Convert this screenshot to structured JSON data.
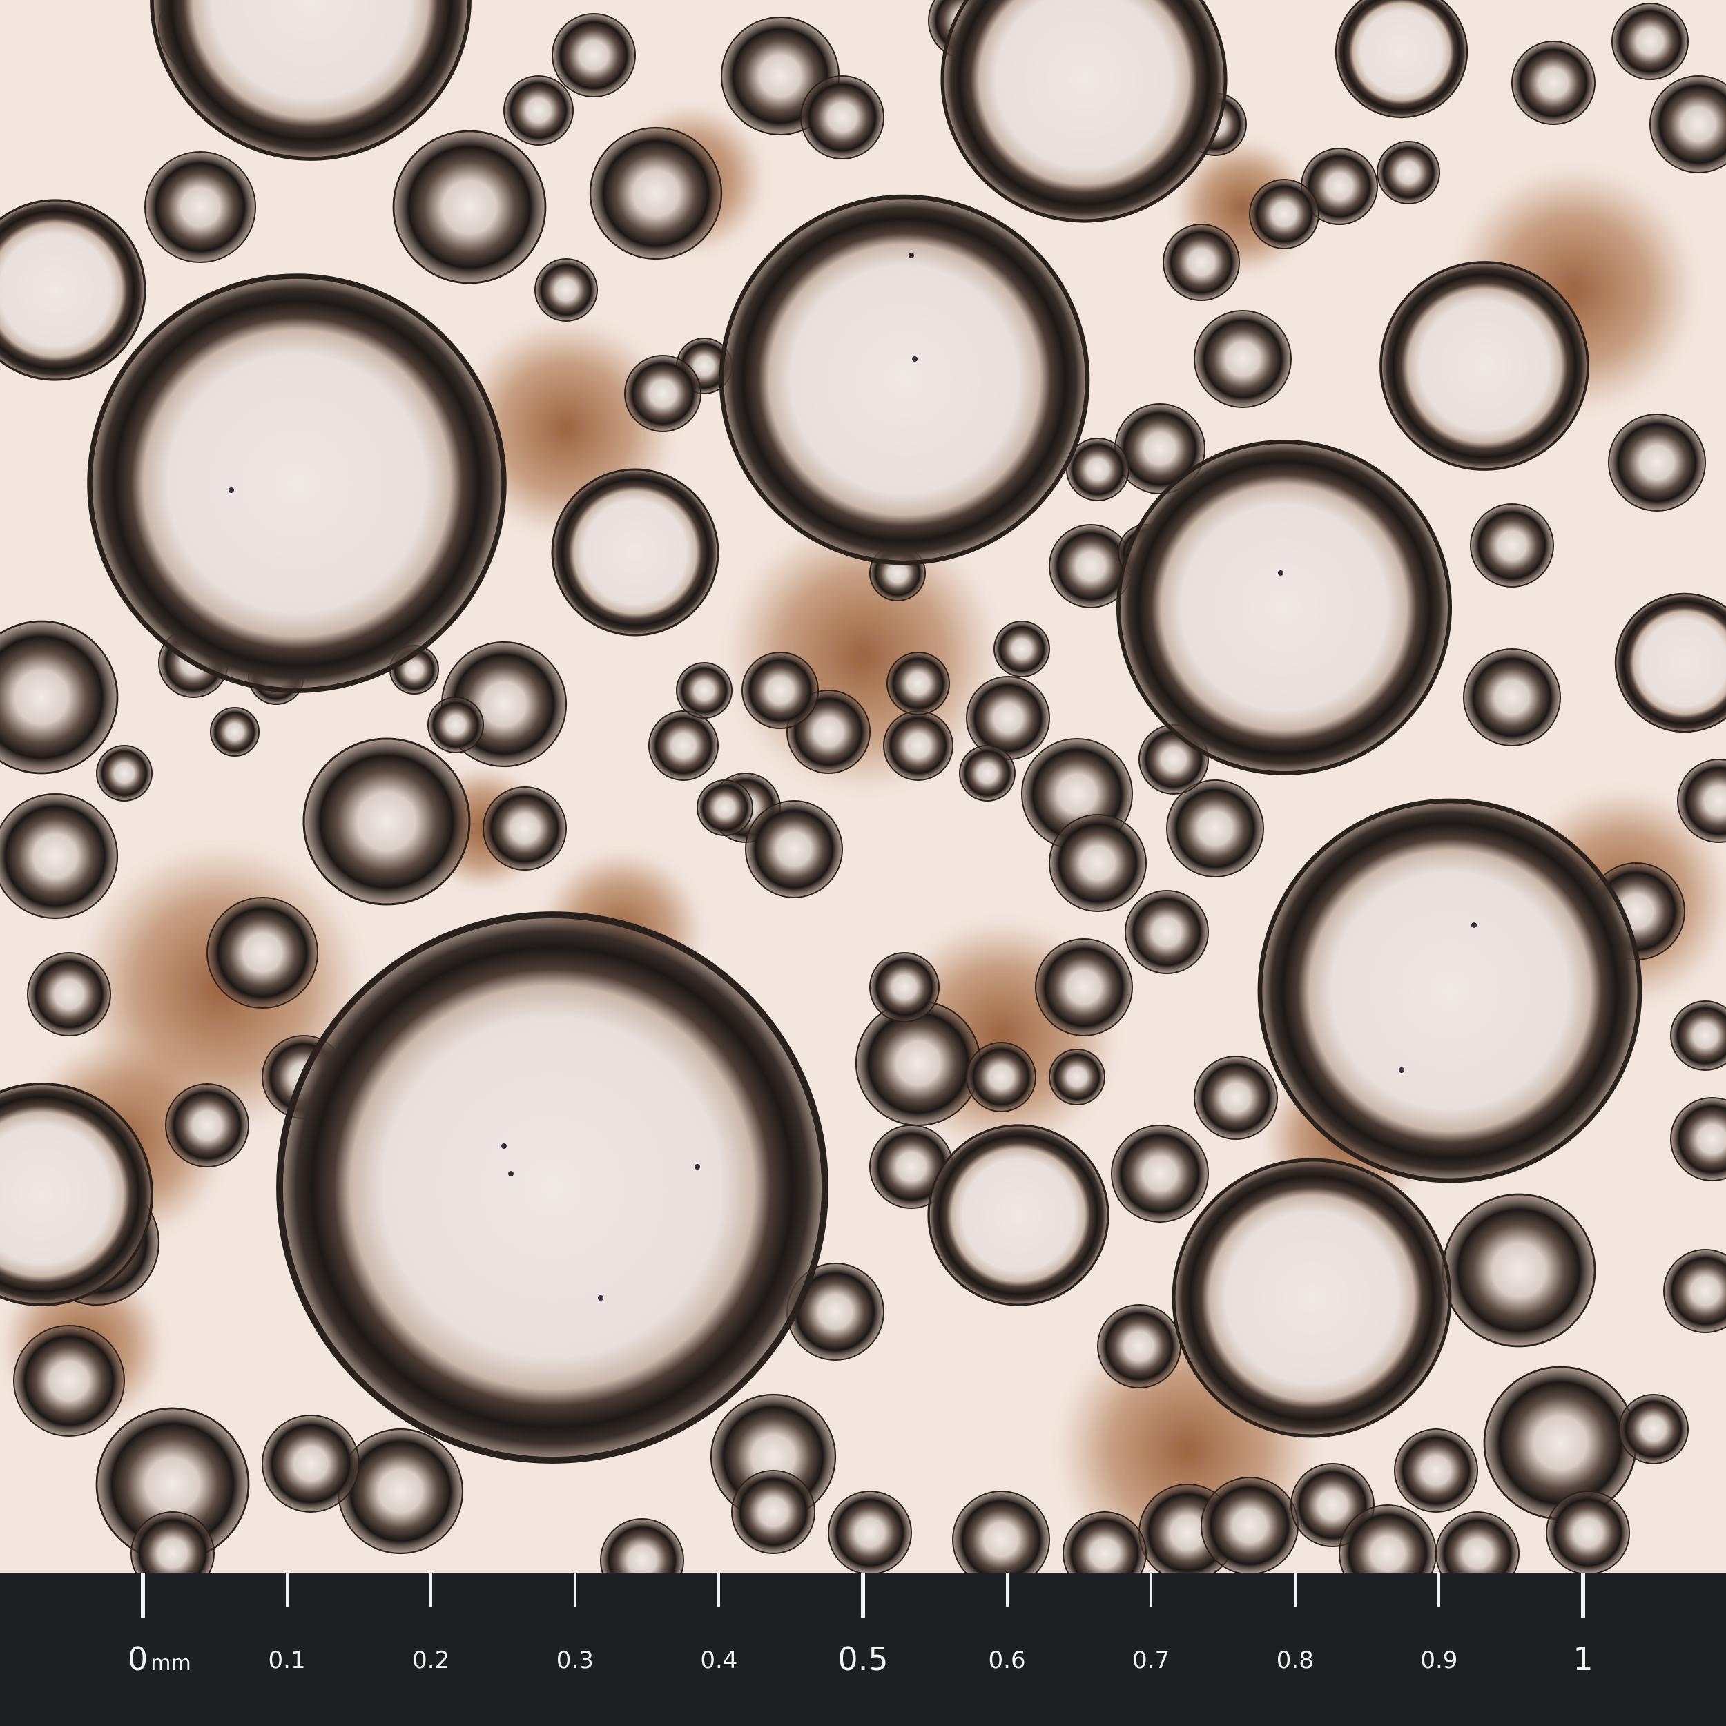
{
  "image": {
    "subject": "",
    "colors": {
      "background": "#f2e6df",
      "cytoplasm": "#8a4a22",
      "bubble_rim": "#1f1a18",
      "bubble_center": "#ece5e2",
      "scale_bar": "#1c2023",
      "scale_text": "#f4f4f4"
    }
  },
  "scale_bar": {
    "unit": "mm",
    "ticks": [
      {
        "value": 0,
        "label": "0",
        "major": true
      },
      {
        "value": 0.1,
        "label": "0.1",
        "major": false
      },
      {
        "value": 0.2,
        "label": "0.2",
        "major": false
      },
      {
        "value": 0.3,
        "label": "0.3",
        "major": false
      },
      {
        "value": 0.4,
        "label": "0.4",
        "major": false
      },
      {
        "value": 0.5,
        "label": "0.5",
        "major": true
      },
      {
        "value": 0.6,
        "label": "0.6",
        "major": false
      },
      {
        "value": 0.7,
        "label": "0.7",
        "major": false
      },
      {
        "value": 0.8,
        "label": "0.8",
        "major": false
      },
      {
        "value": 0.9,
        "label": "0.9",
        "major": false
      },
      {
        "value": 1,
        "label": "1",
        "major": true
      }
    ]
  }
}
